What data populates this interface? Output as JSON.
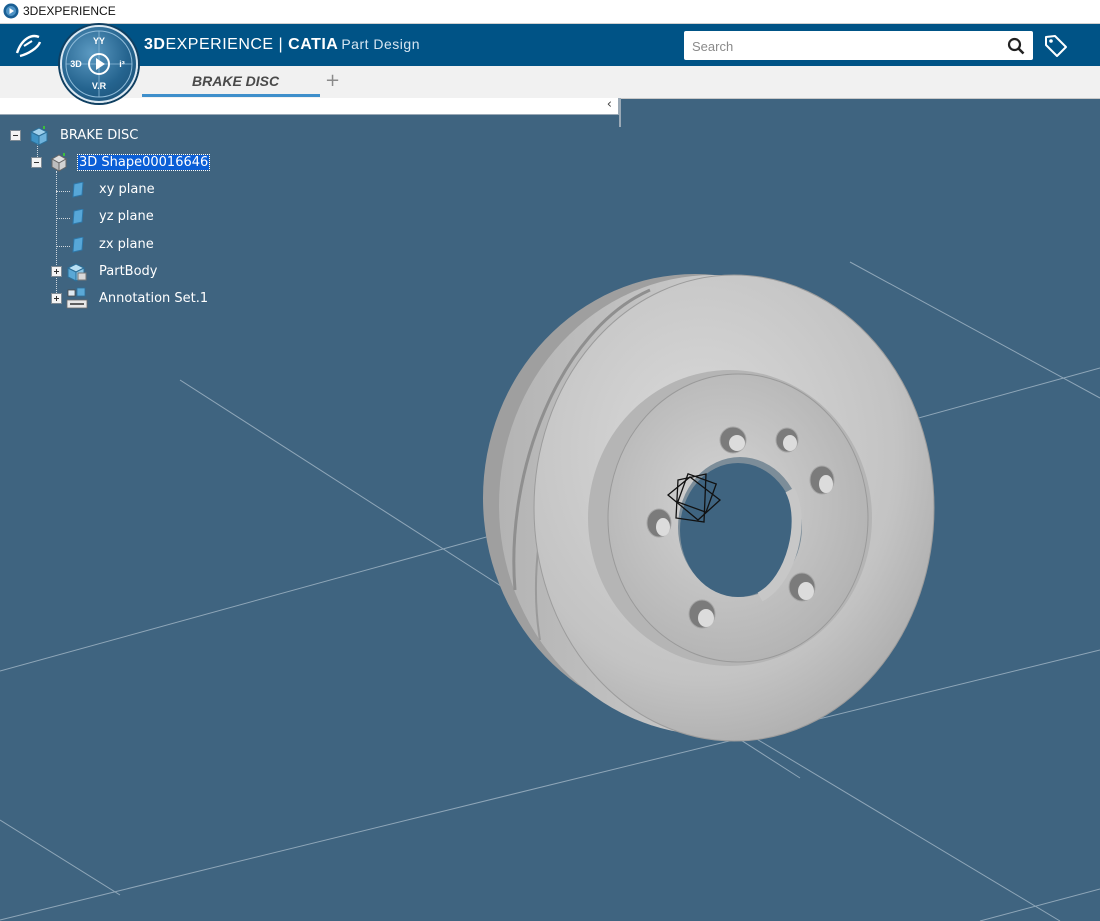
{
  "window": {
    "title": "3DEXPERIENCE"
  },
  "header": {
    "brand_bold": "3D",
    "brand_light": "EXPERIENCE",
    "separator": " | ",
    "product": "CATIA",
    "module": "Part Design",
    "compass": {
      "top_label": "YY",
      "left_label": "3D",
      "right_label": "i³",
      "bottom_label": "V.R"
    },
    "search": {
      "placeholder": "Search",
      "value": ""
    }
  },
  "tabs": [
    {
      "label": "BRAKE DISC",
      "active": true
    }
  ],
  "add_tab_label": "+",
  "tree_panel": {
    "collapse_label": "‹"
  },
  "tree": {
    "root": {
      "label": "BRAKE DISC"
    },
    "shape": {
      "label": "3D Shape00016646",
      "selected": true
    },
    "children": [
      {
        "label": "xy plane"
      },
      {
        "label": "yz plane"
      },
      {
        "label": "zx plane"
      },
      {
        "label": "PartBody"
      },
      {
        "label": "Annotation Set.1"
      }
    ]
  },
  "colors": {
    "viewport_bg": "#3f6480",
    "header_bg": "#005386",
    "tab_accent": "#3e8fcb",
    "selection": "#0a5ed6",
    "part_surface": "#c8c8c8"
  }
}
